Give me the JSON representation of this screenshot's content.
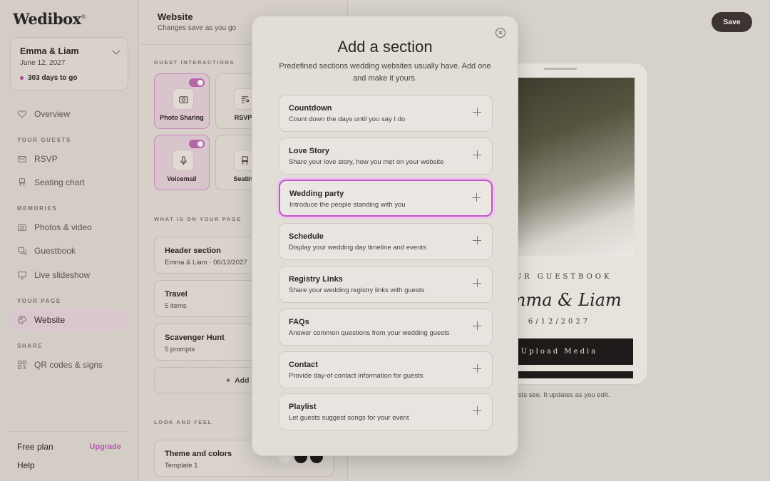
{
  "app": {
    "logo": "Wedibox",
    "logo_mark": "®"
  },
  "event": {
    "names": "Emma & Liam",
    "date": "June 12, 2027",
    "countdown": "303 days to go"
  },
  "sidebar": {
    "overview": "Overview",
    "sections": {
      "guests": "YOUR GUESTS",
      "memories": "MEMORIES",
      "page": "YOUR PAGE",
      "share": "SHARE"
    },
    "items": {
      "rsvp": "RSVP",
      "seating": "Seating chart",
      "photos": "Photos & video",
      "guestbook": "Guestbook",
      "slideshow": "Live slideshow",
      "website": "Website",
      "qr": "QR codes & signs"
    },
    "footer": {
      "plan": "Free plan",
      "upgrade": "Upgrade",
      "help": "Help"
    }
  },
  "editor": {
    "title": "Website",
    "subtitle": "Changes save as you go",
    "guest_interactions_label": "GUEST INTERACTIONS",
    "features": [
      {
        "label": "Photo Sharing",
        "icon": "camera-icon",
        "enabled": true
      },
      {
        "label": "RSVP",
        "icon": "rsvp-icon",
        "enabled": false
      },
      {
        "label": "Voicemail",
        "icon": "microphone-icon",
        "enabled": true
      },
      {
        "label": "Seatin",
        "icon": "chair-icon",
        "enabled": false
      }
    ],
    "on_page_label": "WHAT IS ON YOUR PAGE",
    "page_items": [
      {
        "title": "Header section",
        "sub": "Emma & Liam · 06/12/2027"
      },
      {
        "title": "Travel",
        "sub": "5 items"
      },
      {
        "title": "Scavenger Hunt",
        "sub": "5 prompts"
      }
    ],
    "add_section": "Add a s",
    "look_label": "LOOK AND FEEL",
    "theme": {
      "title": "Theme and colors",
      "sub": "Template 1"
    },
    "swatch_colors": [
      "#e6e1db",
      "#1f1b1a",
      "#1f1b1a"
    ]
  },
  "toolbar": {
    "save_label": "Save"
  },
  "preview": {
    "guestbook": "OUR GUESTBOOK",
    "names": "Emma & Liam",
    "date": "6/12/2027",
    "upload": "Upload Media",
    "caption": "ur guests see. It updates as you edit."
  },
  "modal": {
    "title": "Add a section",
    "description": "Predefined sections wedding websites usually have. Add one and make it yours.",
    "options": [
      {
        "title": "Countdown",
        "desc": "Count down the days until you say I do",
        "selected": false
      },
      {
        "title": "Love Story",
        "desc": "Share your love story, how you met on your website",
        "selected": false
      },
      {
        "title": "Wedding party",
        "desc": "Introduce the people standing with you",
        "selected": true
      },
      {
        "title": "Schedule",
        "desc": "Display your wedding day timeline and events",
        "selected": false
      },
      {
        "title": "Registry Links",
        "desc": "Share your wedding registry links with guests",
        "selected": false
      },
      {
        "title": "FAQs",
        "desc": "Answer common questions from your wedding guests",
        "selected": false
      },
      {
        "title": "Contact",
        "desc": "Provide day-of contact information for guests",
        "selected": false
      },
      {
        "title": "Playlist",
        "desc": "Let guests suggest songs for your event",
        "selected": false
      }
    ]
  },
  "colors": {
    "accent": "#c255c7",
    "brand_dark": "#3d3532",
    "upgrade": "#b85cae"
  }
}
